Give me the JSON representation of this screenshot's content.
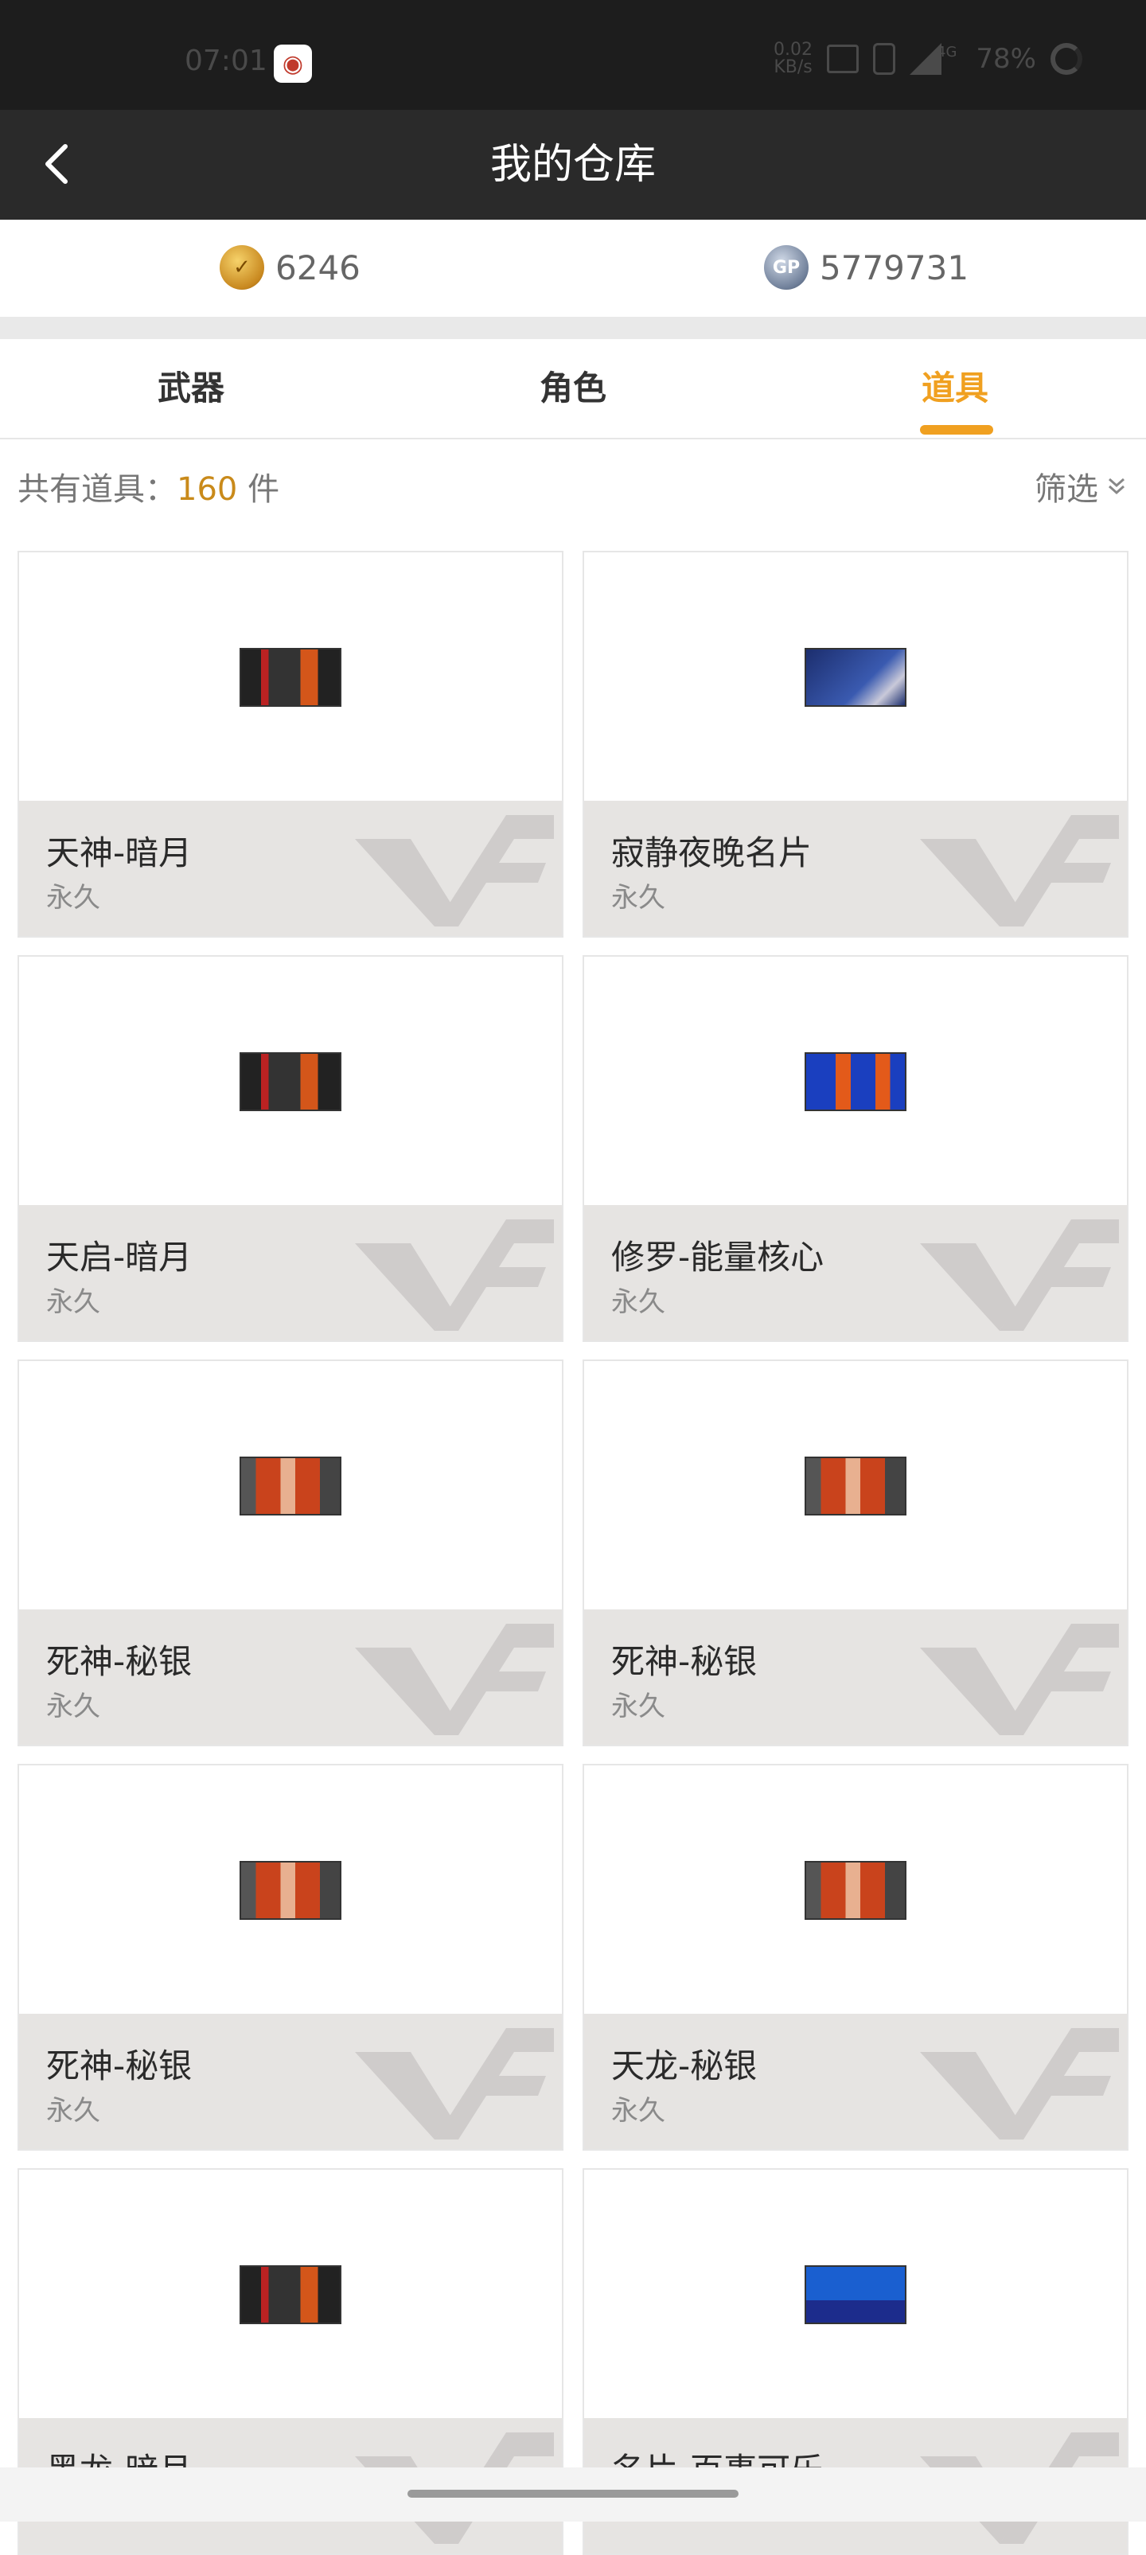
{
  "status_bar": {
    "time": "07:01",
    "net_speed": "0.02",
    "net_speed_unit": "KB/s",
    "network": "4G",
    "battery": "78%"
  },
  "header": {
    "title": "我的仓库"
  },
  "balances": {
    "coin": "6246",
    "gp_label": "GP",
    "gp": "5779731"
  },
  "tabs": [
    {
      "label": "武器",
      "active": false
    },
    {
      "label": "角色",
      "active": false
    },
    {
      "label": "道具",
      "active": true
    }
  ],
  "count": {
    "label": "共有道具：",
    "value": "160",
    "unit": "件"
  },
  "filter_label": "筛选",
  "items": [
    {
      "name": "天神-暗月",
      "term": "永久",
      "thumb": "weapon-dark"
    },
    {
      "name": "寂静夜晚名片",
      "term": "永久",
      "thumb": "night"
    },
    {
      "name": "天启-暗月",
      "term": "永久",
      "thumb": "weapon-dark"
    },
    {
      "name": "修罗-能量核心",
      "term": "永久",
      "thumb": "blue-orange"
    },
    {
      "name": "死神-秘银",
      "term": "永久",
      "thumb": "flame"
    },
    {
      "name": "死神-秘银",
      "term": "永久",
      "thumb": "flame"
    },
    {
      "name": "死神-秘银",
      "term": "永久",
      "thumb": "flame"
    },
    {
      "name": "天龙-秘银",
      "term": "永久",
      "thumb": "flame"
    },
    {
      "name": "黑龙-暗月",
      "term": "",
      "thumb": "weapon-dark"
    },
    {
      "name": "名片-百事可乐",
      "term": "",
      "thumb": "pepsi"
    }
  ],
  "colors": {
    "accent": "#f0a020",
    "header_bg": "#2a2a2a",
    "card_bottom": "#e6e4e2"
  }
}
